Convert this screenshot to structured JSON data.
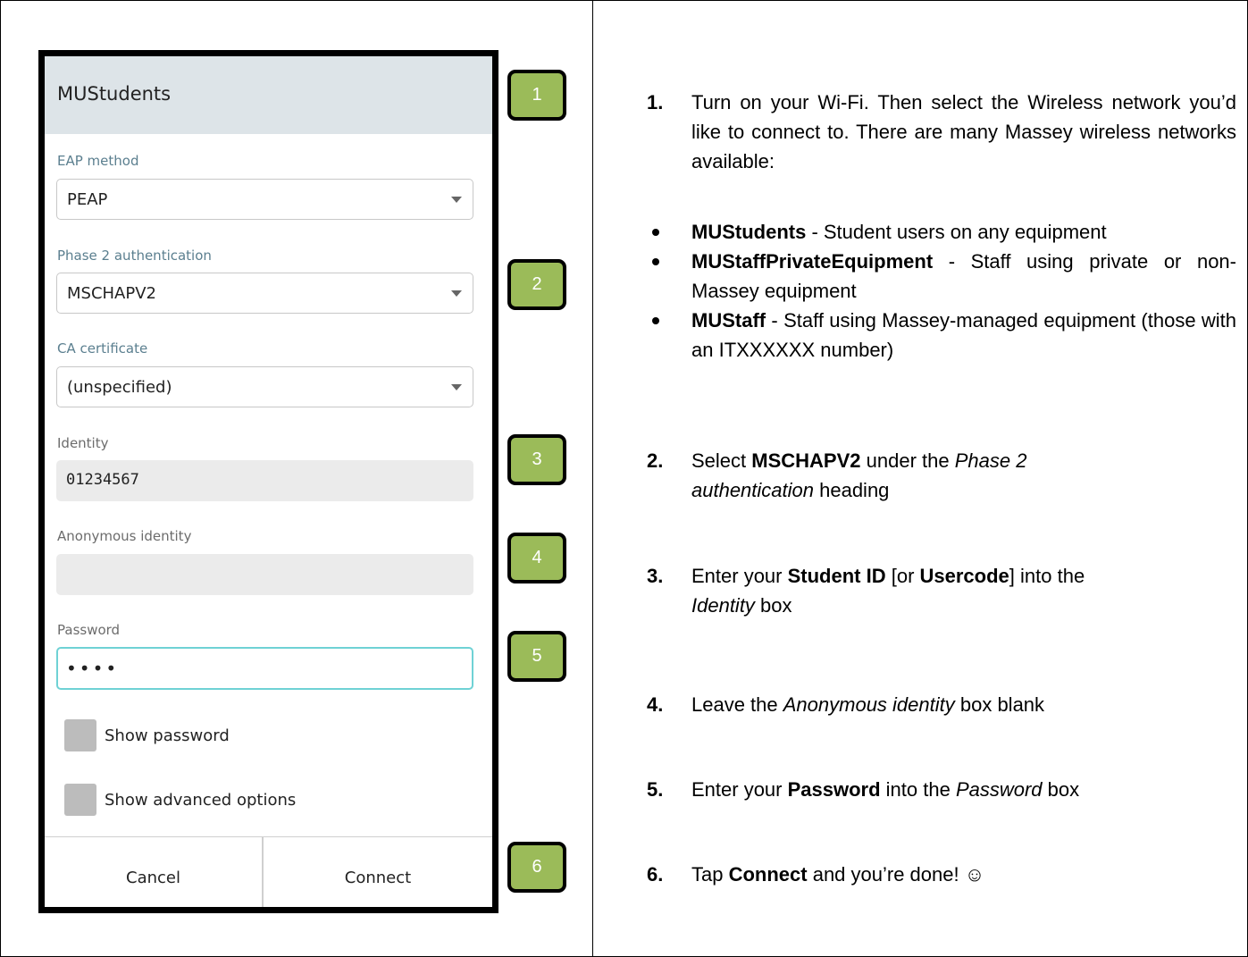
{
  "dialog": {
    "title": "MUStudents",
    "eap_label": "EAP method",
    "eap_value": "PEAP",
    "phase2_label": "Phase 2 authentication",
    "phase2_value": "MSCHAPV2",
    "ca_label": "CA certificate",
    "ca_value": "(unspecified)",
    "identity_label": "Identity",
    "identity_value": "01234567",
    "anon_label": "Anonymous identity",
    "anon_value": "",
    "password_label": "Password",
    "password_value": "••••",
    "show_password_label": "Show password",
    "show_advanced_label": "Show advanced options",
    "cancel_label": "Cancel",
    "connect_label": "Connect"
  },
  "badges": [
    "1",
    "2",
    "3",
    "4",
    "5",
    "6"
  ],
  "badge_color": "#9bbb59",
  "instructions": {
    "step1": {
      "num": "1.",
      "text": "Turn on your Wi-Fi. Then select the Wireless network you’d like to connect to. There are many Massey wireless networks available:"
    },
    "networks": [
      {
        "name": "MUStudents",
        "desc": " - Student users on any equipment"
      },
      {
        "name": "MUStaffPrivateEquipment",
        "desc": " - Staff using private or non-Massey equipment"
      },
      {
        "name": "MUStaff",
        "desc": " - Staff using Massey-managed equipment (those with an ITXXXXXX number)"
      }
    ],
    "step2": {
      "num": "2.",
      "a": "Select ",
      "b": "MSCHAPV2",
      "c": " under the ",
      "d": "Phase 2 authentication",
      "e": " heading"
    },
    "step3": {
      "num": "3.",
      "a": "Enter your ",
      "b": "Student ID",
      "c": " [or ",
      "d": "Usercode",
      "e": "] into the ",
      "f": "Identity",
      "g": " box"
    },
    "step4": {
      "num": "4.",
      "a": "Leave the ",
      "b": "Anonymous identity",
      "c": " box blank"
    },
    "step5": {
      "num": "5.",
      "a": "Enter your ",
      "b": "Password",
      "c": " into the ",
      "d": "Password",
      "e": " box"
    },
    "step6": {
      "num": "6.",
      "a": "Tap ",
      "b": "Connect",
      "c": " and you’re done! ☺"
    }
  }
}
